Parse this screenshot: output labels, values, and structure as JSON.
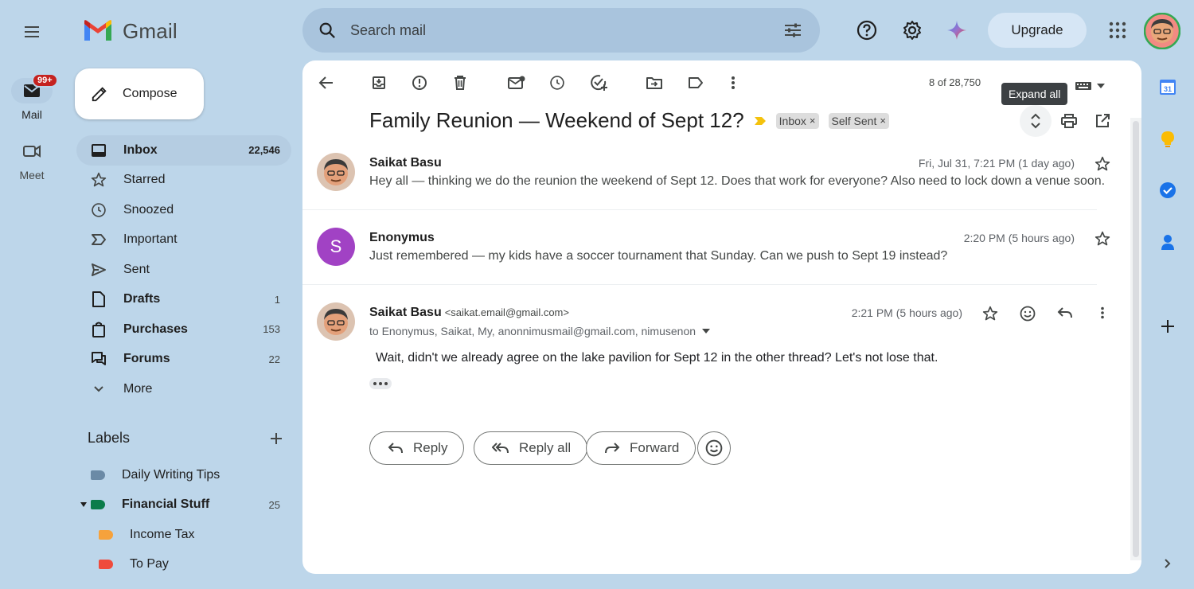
{
  "app": {
    "name": "Gmail"
  },
  "search": {
    "placeholder": "Search mail"
  },
  "header": {
    "upgrade_label": "Upgrade"
  },
  "rail": [
    {
      "label": "Mail",
      "badge": "99+"
    },
    {
      "label": "Meet"
    }
  ],
  "compose_label": "Compose",
  "nav": [
    {
      "label": "Inbox",
      "count": "22,546",
      "icon": "inbox-icon"
    },
    {
      "label": "Starred",
      "count": "",
      "icon": "star-icon"
    },
    {
      "label": "Snoozed",
      "count": "",
      "icon": "clock-icon"
    },
    {
      "label": "Important",
      "count": "",
      "icon": "important-icon"
    },
    {
      "label": "Sent",
      "count": "",
      "icon": "send-icon"
    },
    {
      "label": "Drafts",
      "count": "1",
      "icon": "draft-icon"
    },
    {
      "label": "Purchases",
      "count": "153",
      "icon": "bag-icon"
    },
    {
      "label": "Forums",
      "count": "22",
      "icon": "forum-icon"
    },
    {
      "label": "More",
      "count": "",
      "icon": "chevron-down-icon"
    }
  ],
  "labels": {
    "title": "Labels",
    "items": [
      {
        "name": "Daily Writing Tips",
        "count": "",
        "color": "#6b8aa6"
      },
      {
        "name": "Financial Stuff",
        "count": "25",
        "color": "#0b7c4a"
      },
      {
        "name": "Income Tax",
        "count": "",
        "color": "#f6a23c"
      },
      {
        "name": "To Pay",
        "count": "",
        "color": "#ef4b3c"
      }
    ]
  },
  "thread": {
    "pager": "8 of 28,750",
    "tooltip": "Expand all",
    "subject": "Family Reunion — Weekend of Sept 12?",
    "chips": [
      "Inbox",
      "Self Sent"
    ],
    "chip_close": "×",
    "messages": [
      {
        "sender": "Saikat Basu",
        "date": "Fri, Jul 31, 7:21 PM (1 day ago)",
        "snippet": "Hey all — thinking we do the reunion the weekend of Sept 12. Does that work for everyone? Also need to lock down a venue soon."
      },
      {
        "sender": "Enonymus",
        "avatar_letter": "S",
        "date": "2:20 PM (5 hours ago)",
        "snippet": "Just remembered — my kids have a soccer tournament that Sunday. Can we push to Sept 19 instead?"
      },
      {
        "sender": "Saikat Basu",
        "email": "<saikat.email@gmail.com>",
        "to": "to Enonymus, Saikat, My, anonnimusmail@gmail.com, nimusenon",
        "date": "2:21 PM (5 hours ago)",
        "body": "Wait, didn't we already agree on the lake pavilion for Sept 12 in the other thread? Let's not lose that."
      }
    ],
    "actions": {
      "reply": "Reply",
      "reply_all": "Reply all",
      "forward": "Forward"
    }
  },
  "colors": {
    "background": "#bdd6ea",
    "accent": "#0b57d0",
    "badge": "#c5221f",
    "avatar_purple": "#a142c4"
  }
}
